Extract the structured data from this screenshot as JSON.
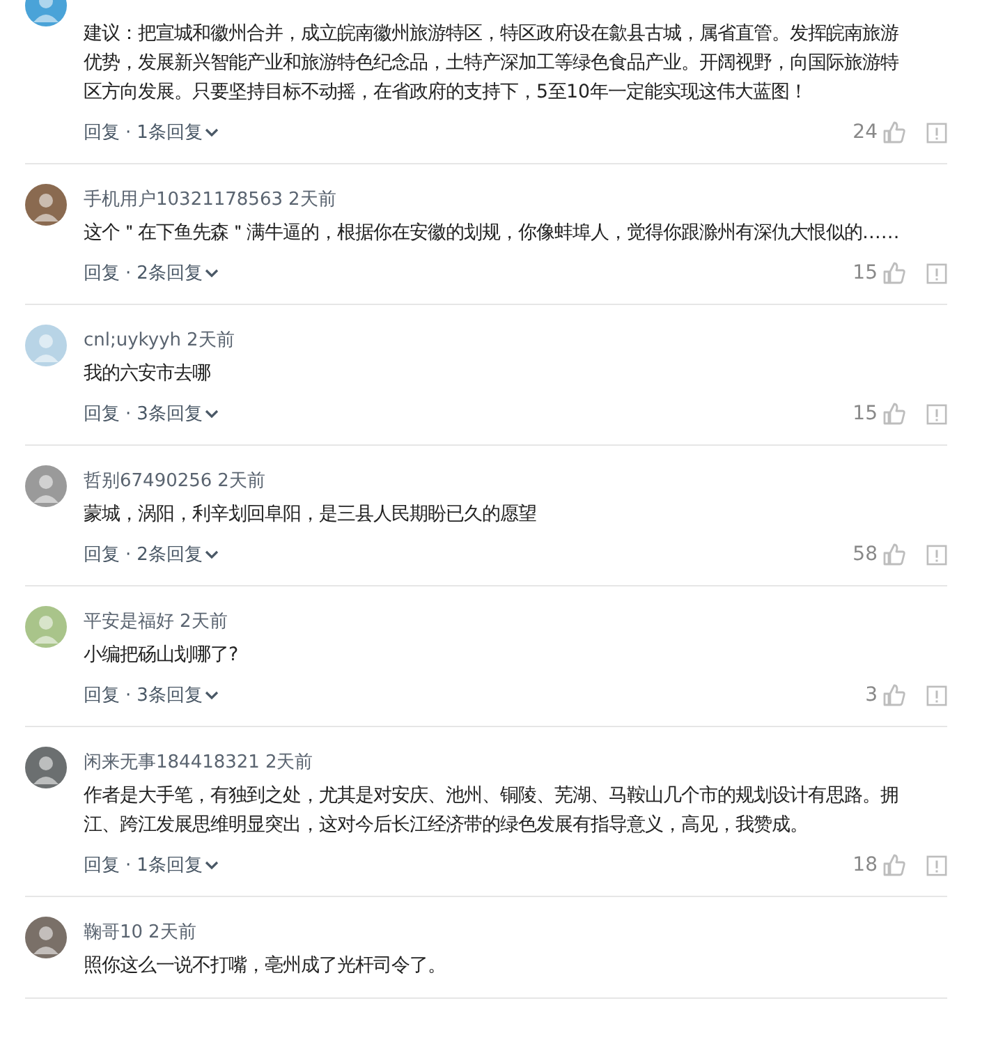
{
  "comments": [
    {
      "avatar": {
        "color": "#4aa3d8"
      },
      "text": "建议：把宣城和徽州合并，成立皖南徽州旅游特区，特区政府设在歙县古城，属省直管。发挥皖南旅游优势，发展新兴智能产业和旅游特色纪念品，土特产深加工等绿色食品产业。开阔视野，向国际旅游特区方向发展。只要坚持目标不动摇，在省政府的支持下，5至10年一定能实现这伟大蓝图！",
      "reply": "回复",
      "separator": "·",
      "replies": "1条回复",
      "likes": "24"
    },
    {
      "avatar": {
        "color": "#8a6a50"
      },
      "name": "手机用户10321178563",
      "time": "2天前",
      "text": "这个＂在下鱼先森＂满牛逼的，根据你在安徽的划规，你像蚌埠人，觉得你跟滁州有深仇大恨似的……",
      "reply": "回复",
      "separator": "·",
      "replies": "2条回复",
      "likes": "15"
    },
    {
      "avatar": {
        "color": "#b8d4e6"
      },
      "name": "cnl;uykyyh",
      "time": "2天前",
      "text": "我的六安市去哪",
      "reply": "回复",
      "separator": "·",
      "replies": "3条回复",
      "likes": "15"
    },
    {
      "avatar": {
        "color": "#9a9a9a"
      },
      "name": "哲别67490256",
      "time": "2天前",
      "text": "蒙城，涡阳，利辛划回阜阳，是三县人民期盼已久的愿望",
      "reply": "回复",
      "separator": "·",
      "replies": "2条回复",
      "likes": "58"
    },
    {
      "avatar": {
        "color": "#a9c48a"
      },
      "name": "平安是福好",
      "time": "2天前",
      "text": "小编把砀山划哪了?",
      "reply": "回复",
      "separator": "·",
      "replies": "3条回复",
      "likes": "3"
    },
    {
      "avatar": {
        "color": "#6b6f70"
      },
      "name": "闲来无事184418321",
      "time": "2天前",
      "text": "作者是大手笔，有独到之处，尤其是对安庆、池州、铜陵、芜湖、马鞍山几个市的规划设计有思路。拥江、跨江发展思维明显突出，这对今后长江经济带的绿色发展有指导意义，高见，我赞成。",
      "reply": "回复",
      "separator": "·",
      "replies": "1条回复",
      "likes": "18"
    },
    {
      "avatar": {
        "color": "#7a7068"
      },
      "name": "鞠哥10",
      "time": "2天前",
      "text": "照你这么一说不打嘴，亳州成了光杆司令了。"
    }
  ]
}
